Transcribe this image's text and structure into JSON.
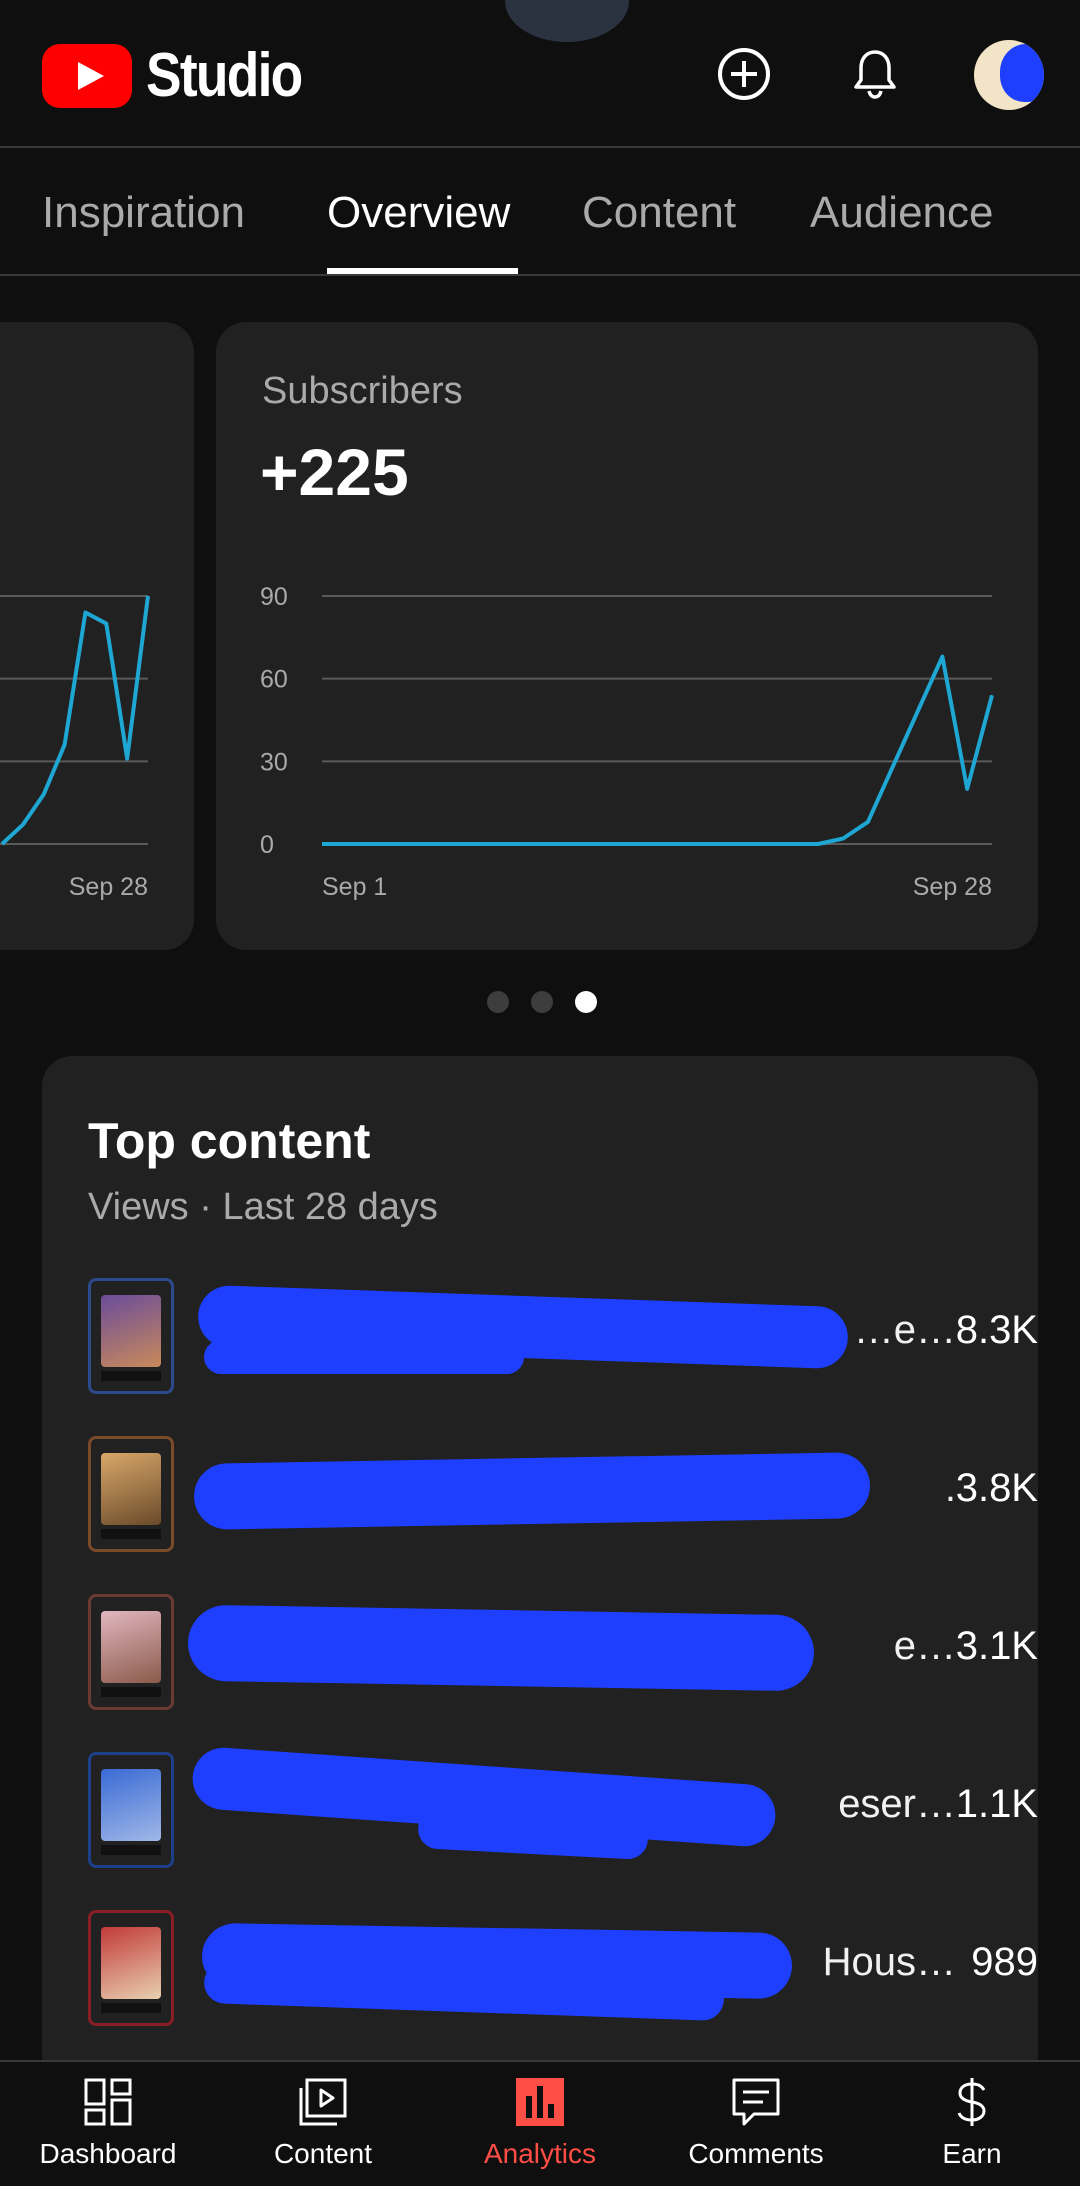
{
  "header": {
    "app_name": "Studio",
    "create_icon": "plus-circle-icon",
    "notifications_icon": "bell-icon",
    "avatar": "channel-avatar"
  },
  "tabs": [
    {
      "label": "Inspiration",
      "active": false
    },
    {
      "label": "Overview",
      "active": true
    },
    {
      "label": "Content",
      "active": false
    },
    {
      "label": "Audience",
      "active": false
    }
  ],
  "charts": {
    "prev_card": {
      "x_end_label": "Sep 28"
    },
    "subscribers": {
      "label": "Subscribers",
      "value": "+225",
      "x_start_label": "Sep 1",
      "x_end_label": "Sep 28"
    }
  },
  "chart_data": [
    {
      "type": "line",
      "title": "",
      "partially_visible": true,
      "x": [
        21,
        22,
        23,
        24,
        25,
        26,
        27,
        28
      ],
      "series": [
        {
          "values": [
            0,
            7,
            18,
            36,
            84,
            80,
            31,
            90
          ]
        }
      ],
      "ylim": [
        0,
        90
      ],
      "y_ticks": [
        0,
        30,
        60,
        90
      ],
      "x_tick_labels": [
        "Sep 28"
      ],
      "grid": true,
      "color": "#1fa7d4"
    },
    {
      "type": "line",
      "title": "Subscribers",
      "x": [
        1,
        2,
        3,
        4,
        5,
        6,
        7,
        8,
        9,
        10,
        11,
        12,
        13,
        14,
        15,
        16,
        17,
        18,
        19,
        20,
        21,
        22,
        23,
        24,
        25,
        26,
        27,
        28
      ],
      "series": [
        {
          "values": [
            0,
            0,
            0,
            0,
            0,
            0,
            0,
            0,
            0,
            0,
            0,
            0,
            0,
            0,
            0,
            0,
            0,
            0,
            0,
            0,
            0,
            2,
            8,
            28,
            48,
            68,
            20,
            54
          ]
        }
      ],
      "ylim": [
        0,
        90
      ],
      "y_ticks": [
        0,
        30,
        60,
        90
      ],
      "x_tick_labels": [
        "Sep 1",
        "Sep 28"
      ],
      "grid": true,
      "color": "#1fa7d4"
    }
  ],
  "carousel": {
    "count": 3,
    "active_index": 2
  },
  "top_content": {
    "title": "Top content",
    "subtitle": "Views · Last 28 days",
    "rows": [
      {
        "title_visible": "…e…",
        "views": "8.3K",
        "thumb_color": "#2d4a8a"
      },
      {
        "title_visible": ".",
        "views": "3.8K",
        "thumb_color": "#7a4a2a"
      },
      {
        "title_visible": "e…",
        "views": "3.1K",
        "thumb_color": "#6a3a34"
      },
      {
        "title_visible": "eser…",
        "views": "1.1K",
        "thumb_color": "#1e3f8a"
      },
      {
        "title_visible": "Hous…",
        "views": "989",
        "thumb_color": "#8a1e24"
      }
    ]
  },
  "bottom_nav": [
    {
      "label": "Dashboard",
      "icon": "dashboard-icon",
      "active": false
    },
    {
      "label": "Content",
      "icon": "content-icon",
      "active": false
    },
    {
      "label": "Analytics",
      "icon": "analytics-icon",
      "active": true
    },
    {
      "label": "Comments",
      "icon": "comments-icon",
      "active": false
    },
    {
      "label": "Earn",
      "icon": "dollar-icon",
      "active": false
    }
  ],
  "colors": {
    "accent": "#ff0000",
    "active_nav": "#ff4e45",
    "chart_line": "#1fa7d4",
    "redaction": "#1f3fff"
  }
}
